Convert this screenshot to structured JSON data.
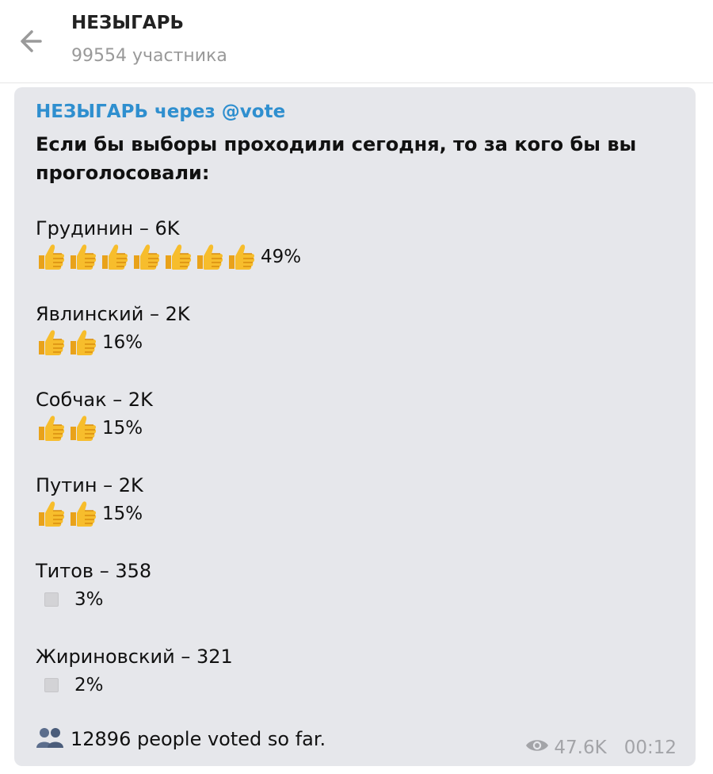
{
  "header": {
    "title": "НЕЗЫГАРЬ",
    "subtitle": "99554 участника"
  },
  "message": {
    "via": "НЕЗЫГАРЬ через @vote",
    "question": "Если бы выборы проходили сегодня, то за кого бы вы проголосовали:",
    "options": [
      {
        "label": "Грудинин – 6K",
        "percent": "49%",
        "thumbs": 7
      },
      {
        "label": "Явлинский – 2K",
        "percent": "16%",
        "thumbs": 2
      },
      {
        "label": "Собчак – 2K",
        "percent": "15%",
        "thumbs": 2
      },
      {
        "label": "Путин – 2K",
        "percent": "15%",
        "thumbs": 2
      },
      {
        "label": "Титов – 358",
        "percent": "3%",
        "thumbs": 0
      },
      {
        "label": "Жириновский – 321",
        "percent": "2%",
        "thumbs": 0
      }
    ],
    "voted_text": "12896 people voted so far.",
    "views": "47.6K",
    "time": "00:12"
  },
  "icons": {
    "back": "back-arrow-icon",
    "thumb": "thumbs-up-icon",
    "people": "people-icon",
    "views": "eye-icon"
  },
  "colors": {
    "bubble": "#e6e7eb",
    "link": "#2f8fcf",
    "meta": "#a3a4a8"
  }
}
